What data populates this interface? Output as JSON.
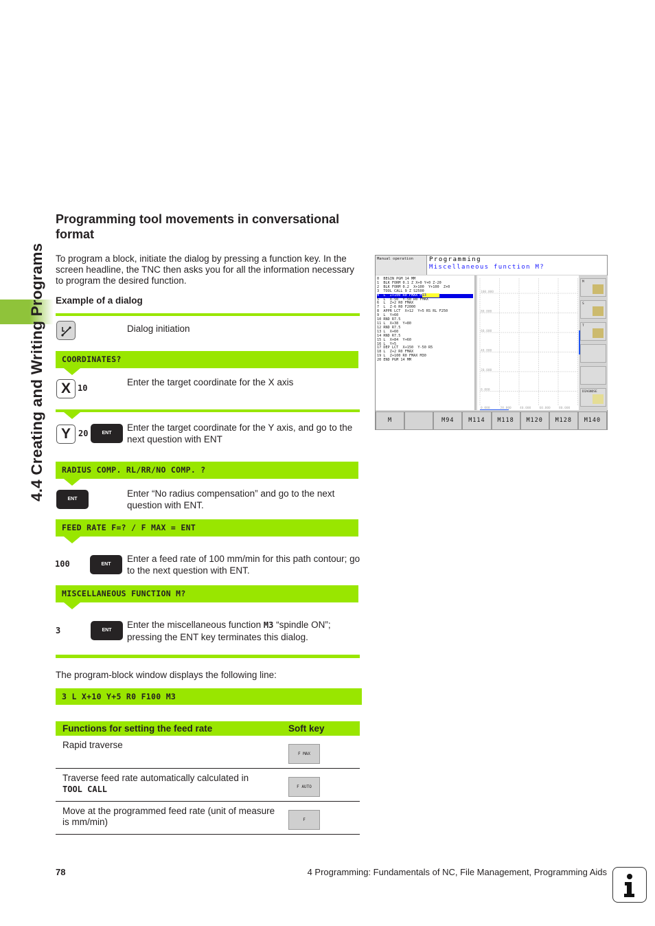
{
  "side_tab": {
    "title": "4.4 Creating and Writing Programs"
  },
  "section": {
    "title": "Programming tool movements in conversational format",
    "intro": "To program a block, initiate the dialog by pressing a function key. In the screen headline, the TNC then asks you for all the information necessary to program the desired function.",
    "example_heading": "Example of a dialog"
  },
  "dialog": {
    "initiation": "Dialog initiation",
    "prompt_coordinates": "COORDINATES?",
    "x_key": "X",
    "x_value": "10",
    "x_desc": "Enter the target coordinate for the X axis",
    "y_key": "Y",
    "y_value": "20",
    "y_desc": "Enter the target coordinate for the Y axis, and go to the next question with ENT",
    "ent_label": "ENT",
    "prompt_radius": "RADIUS COMP. RL/RR/NO COMP. ?",
    "radius_desc": "Enter “No radius compensation” and go to the next question with ENT.",
    "prompt_feed": "FEED RATE F=? / F MAX = ENT",
    "feed_value": "100",
    "feed_desc": "Enter a feed rate of 100 mm/min for this path contour; go to the next question with ENT.",
    "prompt_misc": "MISCELLANEOUS FUNCTION M?",
    "misc_value": "3",
    "misc_desc_pre": "Enter the miscellaneous function ",
    "misc_desc_code": "M3",
    "misc_desc_post": " “spindle ON”; pressing the ENT key terminates this dialog.",
    "result_intro": "The program-block window displays the following line:",
    "result_line": "3 L X+10 Y+5 R0 F100 M3"
  },
  "feed_table": {
    "headers": [
      "Functions for setting the feed rate",
      "Soft key"
    ],
    "rows": [
      {
        "text": "Rapid traverse",
        "code": "",
        "softkey": "F MAX"
      },
      {
        "text": "Traverse feed rate automatically calculated in",
        "code": "TOOL CALL",
        "softkey": "F AUTO"
      },
      {
        "text": "Move at the programmed feed rate (unit of measure is mm/min)",
        "code": "",
        "softkey": "F"
      }
    ]
  },
  "tnc_screen": {
    "mode": "Manual operation",
    "header_title": "Programming",
    "header_prompt": "Miscellaneous function M?",
    "program_lines": [
      "0  BEGIN PGM 14 MM",
      "1  BLK FORM 0.1 Z X+0 Y+0 Z-20",
      "2  BLK FORM 0.2  X+100  Y+100  Z+0",
      "3  TOOL CALL 9 Z S2500",
      "4  L  Z+100 R0 FMAX M",
      "5  L  X-50  Y-50 R0 FMAX",
      "6  L  Z+2 R0 FMAX",
      "7  L  Z-6 R0 F2000",
      "8  APPR LCT  X+12  Y+5 RS RL F250",
      "9  L  Y+60",
      "10 RND R7.5",
      "11 L  X+38  Y+80",
      "12 RND R7.5",
      "13 L  X+60",
      "14 RND R7.5",
      "15 L  X+84  Y+60",
      "16 L  Y+5",
      "17 DEP LCT  X+150  Y-50 R5",
      "18 L  Z+2 R0 FMAX",
      "19 L  Z+100 R0 FMAX M30",
      "20 END PGM 14 MM"
    ],
    "selected_line_index": 4,
    "selected_line_cursor": "13",
    "graph_y_labels": [
      "100.000",
      "80.000",
      "60.000",
      "40.000",
      "20.000",
      "0.000"
    ],
    "graph_x_labels": [
      "0.000",
      "20.000",
      "40.000",
      "60.000",
      "80.000"
    ],
    "side_softkeys": [
      "M",
      "S",
      "T",
      "",
      "",
      "DIAGNOSE"
    ],
    "bottom_softkeys": [
      "M",
      "",
      "M94",
      "M114",
      "M118",
      "M120",
      "M128",
      "M140"
    ]
  },
  "footer": {
    "page_number": "78",
    "chapter_title": "4 Programming: Fundamentals of NC, File Management, Programming Aids"
  }
}
